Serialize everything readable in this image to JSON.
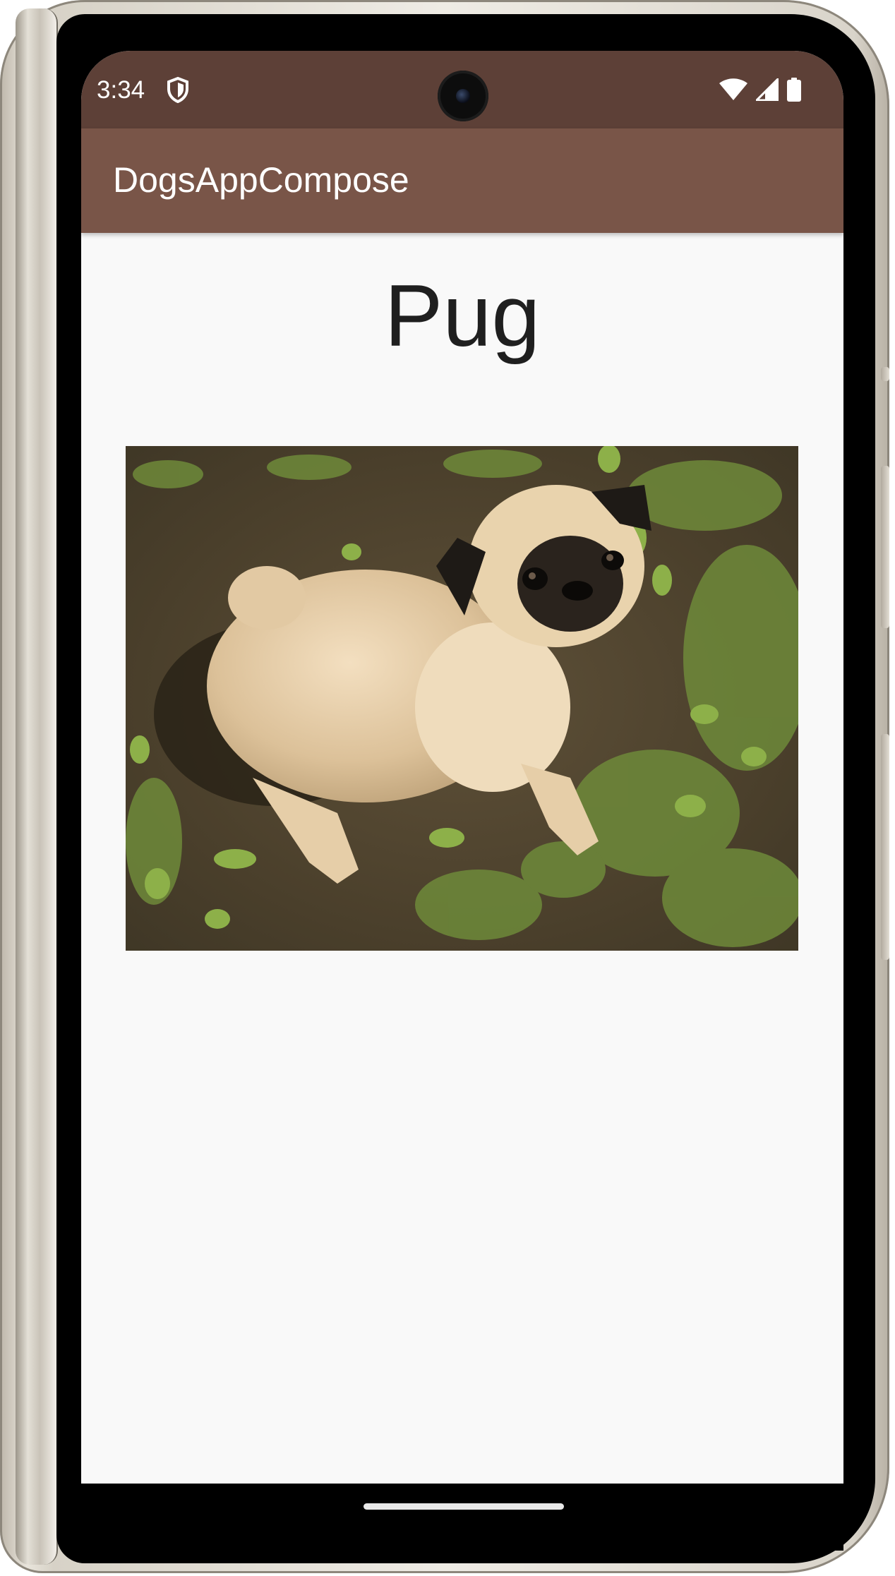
{
  "status_bar": {
    "time": "3:34",
    "icons": [
      "shield-icon",
      "wifi-icon",
      "signal-icon",
      "battery-icon"
    ],
    "background_color": "#5d4037"
  },
  "app_bar": {
    "title": "DogsAppCompose",
    "background_color": "#795548"
  },
  "content": {
    "breed_name": "Pug",
    "image": {
      "description_icon": "pug-photo"
    }
  }
}
